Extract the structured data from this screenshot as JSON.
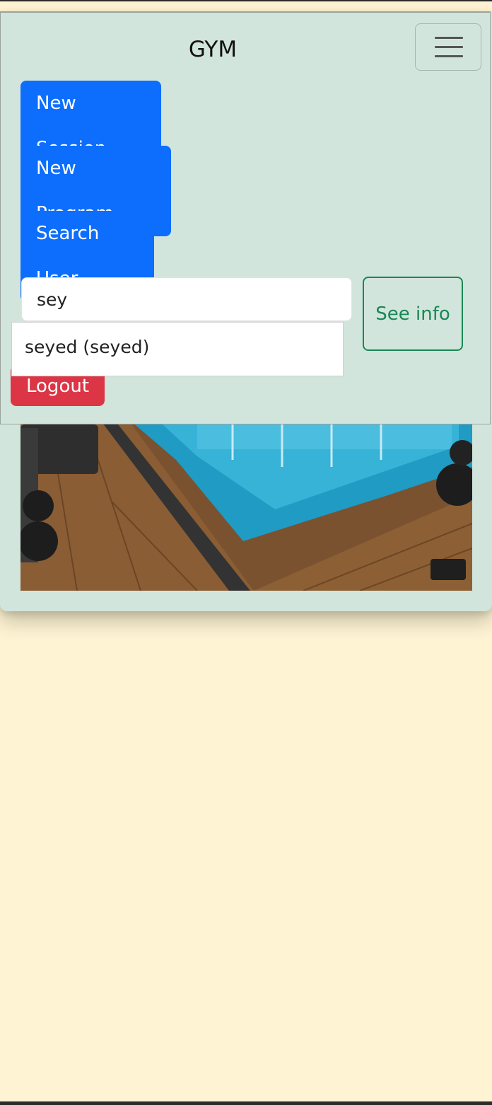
{
  "navbar": {
    "brand": "GYM",
    "toggler_icon": "hamburger-menu-icon"
  },
  "menu": {
    "new_session": "New Session",
    "new_program": "New Program",
    "search_user": "Search User",
    "logout": "Logout"
  },
  "search": {
    "value": "sey",
    "button_label": "See info",
    "suggestions": [
      "seyed (seyed)"
    ]
  },
  "colors": {
    "page_bg": "#fef3d2",
    "card_bg": "#d2e5dc",
    "primary": "#0d6efd",
    "danger": "#dc3545",
    "success": "#198754"
  }
}
